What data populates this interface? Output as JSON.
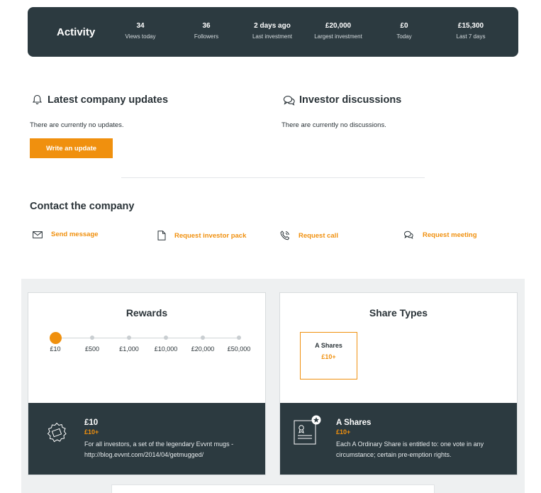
{
  "activity": {
    "title": "Activity",
    "stats": [
      {
        "value": "34",
        "label": "Views today"
      },
      {
        "value": "36",
        "label": "Followers"
      },
      {
        "value": "2 days ago",
        "label": "Last investment"
      },
      {
        "value": "£20,000",
        "label": "Largest investment"
      },
      {
        "value": "£0",
        "label": "Today"
      },
      {
        "value": "£15,300",
        "label": "Last 7 days"
      }
    ]
  },
  "updates": {
    "title": "Latest company updates",
    "empty_text": "There are currently no updates.",
    "button_label": "Write an update"
  },
  "discussions": {
    "title": "Investor discussions",
    "empty_text": "There are currently no discussions."
  },
  "contact": {
    "title": "Contact the company",
    "links": [
      {
        "label": "Send message",
        "icon": "envelope-icon"
      },
      {
        "label": "Request investor pack",
        "icon": "document-icon"
      },
      {
        "label": "Request call",
        "icon": "phone-icon"
      },
      {
        "label": "Request meeting",
        "icon": "chat-bubbles-icon"
      }
    ]
  },
  "rewards": {
    "title": "Rewards",
    "tiers": [
      "£10",
      "£500",
      "£1,000",
      "£10,000",
      "£20,000",
      "£50,000"
    ],
    "selected": {
      "title": "£10",
      "subtitle": "£10+",
      "description": "For all investors, a set of the legendary Evvnt mugs - http://blog.evvnt.com/2014/04/getmugged/"
    }
  },
  "share_types": {
    "title": "Share Types",
    "items": [
      {
        "name": "A Shares",
        "price": "£10+"
      }
    ],
    "selected": {
      "title": "A Shares",
      "subtitle": "£10+",
      "description": "Each A Ordinary Share is entitled to: one vote in any circumstance; certain pre-emption rights."
    }
  },
  "colors": {
    "accent": "#f0900e",
    "dark": "#2c3a40",
    "background_gray": "#eef0f1"
  }
}
